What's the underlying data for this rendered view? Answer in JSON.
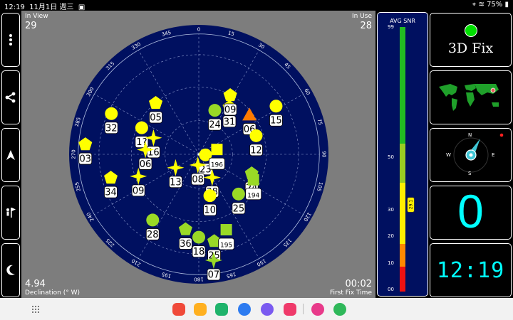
{
  "status_bar": {
    "time": "12:19",
    "date": "11月1日 週三",
    "battery": "75%"
  },
  "sky": {
    "in_view_label": "In View",
    "in_view": "29",
    "in_use_label": "In Use",
    "in_use": "28",
    "declination": "4.94",
    "declination_label": "Declination (° W)",
    "first_fix": "00:02",
    "first_fix_label": "First Fix Time",
    "azimuth_labels": [
      "0",
      "15",
      "30",
      "45",
      "60",
      "75",
      "90",
      "105",
      "120",
      "135",
      "150",
      "165",
      "180",
      "195",
      "210",
      "225",
      "240",
      "255",
      "270",
      "285",
      "300",
      "315",
      "330",
      "345"
    ],
    "satellites": [
      {
        "id": "24",
        "shape": "circle",
        "color": "#9ad926",
        "az": 20,
        "el": 55
      },
      {
        "id": "31",
        "shape": "pentagon",
        "color": "#ffff00",
        "az": 33,
        "el": 48
      },
      {
        "id": "09",
        "shape": "pentagon",
        "color": "#ffff00",
        "az": 28,
        "el": 40
      },
      {
        "id": "06",
        "shape": "triangle",
        "color": "#ff7a00",
        "az": 52,
        "el": 42
      },
      {
        "id": "15",
        "shape": "circle",
        "color": "#ffff00",
        "az": 58,
        "el": 22
      },
      {
        "id": "12",
        "shape": "circle",
        "color": "#ffff00",
        "az": 72,
        "el": 45
      },
      {
        "id": "05",
        "shape": "pentagon",
        "color": "#ffff00",
        "az": 320,
        "el": 40
      },
      {
        "id": "32",
        "shape": "circle",
        "color": "#ffff00",
        "az": 295,
        "el": 18
      },
      {
        "id": "1?",
        "shape": "circle",
        "color": "#ffff00",
        "az": 295,
        "el": 43
      },
      {
        "id": "16",
        "shape": "star",
        "color": "#ffff00",
        "az": 290,
        "el": 54
      },
      {
        "id": "06",
        "shape": "star",
        "color": "#ffff00",
        "az": 275,
        "el": 50
      },
      {
        "id": "03",
        "shape": "pentagon",
        "color": "#ffff00",
        "az": 275,
        "el": 5
      },
      {
        "id": "34",
        "shape": "pentagon",
        "color": "#ffff00",
        "az": 255,
        "el": 22
      },
      {
        "id": "09",
        "shape": "star",
        "color": "#ffff00",
        "az": 250,
        "el": 42
      },
      {
        "id": "13",
        "shape": "star",
        "color": "#ffff00",
        "az": 240,
        "el": 70
      },
      {
        "id": "23",
        "shape": "circle",
        "color": "#ffff00",
        "az": 95,
        "el": 85
      },
      {
        "id": "196",
        "shape": "square",
        "color": "#ffff00",
        "az": 75,
        "el": 76
      },
      {
        "id": "08",
        "shape": "star",
        "color": "#ffff00",
        "az": 185,
        "el": 82
      },
      {
        "id": "38",
        "shape": "star",
        "color": "#ffff00",
        "az": 150,
        "el": 70
      },
      {
        "id": "10",
        "shape": "circle",
        "color": "#ffff00",
        "az": 165,
        "el": 58
      },
      {
        "id": "24",
        "shape": "pentagon",
        "color": "#9ad926",
        "az": 110,
        "el": 48
      },
      {
        "id": "194",
        "shape": "square",
        "color": "#9ad926",
        "az": 115,
        "el": 45
      },
      {
        "id": "25",
        "shape": "circle",
        "color": "#9ad926",
        "az": 135,
        "el": 48
      },
      {
        "id": "28",
        "shape": "circle",
        "color": "#9ad926",
        "az": 215,
        "el": 30
      },
      {
        "id": "36",
        "shape": "pentagon",
        "color": "#9ad926",
        "az": 190,
        "el": 33
      },
      {
        "id": "18",
        "shape": "circle",
        "color": "#9ad926",
        "az": 180,
        "el": 28
      },
      {
        "id": "25",
        "shape": "pentagon",
        "color": "#9ad926",
        "az": 170,
        "el": 24
      },
      {
        "id": "195",
        "shape": "square",
        "color": "#9ad926",
        "az": 160,
        "el": 30
      },
      {
        "id": "07",
        "shape": "star",
        "color": "#9ad926",
        "az": 172,
        "el": 10
      }
    ]
  },
  "snr": {
    "title": "AVG SNR",
    "value": "29.1",
    "ticks": [
      "99",
      "50",
      "30",
      "20",
      "10",
      "00"
    ]
  },
  "fix": {
    "label": "3D Fix",
    "dot_color": "#00e000"
  },
  "compass": {
    "n": "N",
    "e": "E",
    "s": "S",
    "w": "W"
  },
  "speed": {
    "value": "0"
  },
  "clock": {
    "value": "12:19"
  }
}
